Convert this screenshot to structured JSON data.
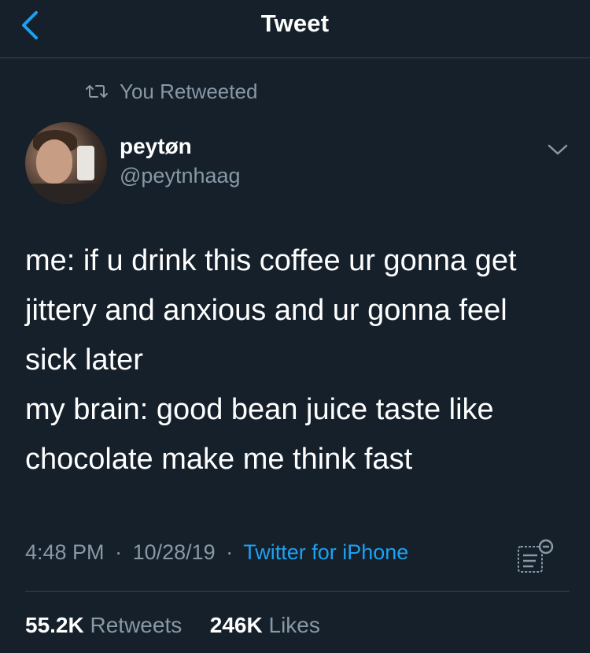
{
  "header": {
    "title": "Tweet"
  },
  "retweet_context": {
    "label": "You Retweeted"
  },
  "author": {
    "display_name": "peytøn",
    "handle": "@peytnhaag"
  },
  "tweet": {
    "text": "me: if u drink this coffee ur gonna get\njittery and anxious and ur gonna feel\nsick later\nmy brain: good bean juice taste like\nchocolate make me think fast"
  },
  "meta": {
    "time": "4:48 PM",
    "date": "10/28/19",
    "separator": "·",
    "source": "Twitter for iPhone"
  },
  "stats": {
    "retweets_count": "55.2K",
    "retweets_label": "Retweets",
    "likes_count": "246K",
    "likes_label": "Likes"
  },
  "colors": {
    "background": "#15202b",
    "accent": "#1da1f2",
    "secondary_text": "#8899a6",
    "divider": "#38444d"
  },
  "icons": {
    "back": "chevron-left-icon",
    "retweet": "retweet-icon",
    "menu": "chevron-down-icon",
    "analytics": "analytics-icon"
  }
}
